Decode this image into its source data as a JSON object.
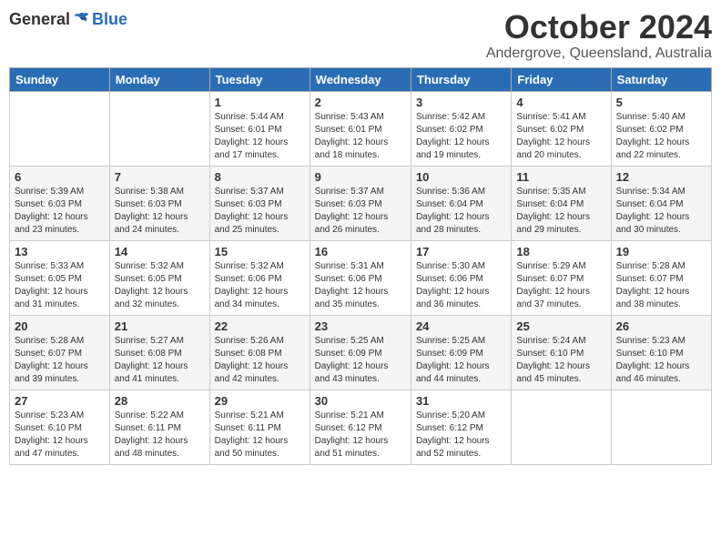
{
  "header": {
    "logo_general": "General",
    "logo_blue": "Blue",
    "month_title": "October 2024",
    "location": "Andergrove, Queensland, Australia"
  },
  "days_of_week": [
    "Sunday",
    "Monday",
    "Tuesday",
    "Wednesday",
    "Thursday",
    "Friday",
    "Saturday"
  ],
  "weeks": [
    [
      {
        "day": "",
        "info": ""
      },
      {
        "day": "",
        "info": ""
      },
      {
        "day": "1",
        "info": "Sunrise: 5:44 AM\nSunset: 6:01 PM\nDaylight: 12 hours\nand 17 minutes."
      },
      {
        "day": "2",
        "info": "Sunrise: 5:43 AM\nSunset: 6:01 PM\nDaylight: 12 hours\nand 18 minutes."
      },
      {
        "day": "3",
        "info": "Sunrise: 5:42 AM\nSunset: 6:02 PM\nDaylight: 12 hours\nand 19 minutes."
      },
      {
        "day": "4",
        "info": "Sunrise: 5:41 AM\nSunset: 6:02 PM\nDaylight: 12 hours\nand 20 minutes."
      },
      {
        "day": "5",
        "info": "Sunrise: 5:40 AM\nSunset: 6:02 PM\nDaylight: 12 hours\nand 22 minutes."
      }
    ],
    [
      {
        "day": "6",
        "info": "Sunrise: 5:39 AM\nSunset: 6:03 PM\nDaylight: 12 hours\nand 23 minutes."
      },
      {
        "day": "7",
        "info": "Sunrise: 5:38 AM\nSunset: 6:03 PM\nDaylight: 12 hours\nand 24 minutes."
      },
      {
        "day": "8",
        "info": "Sunrise: 5:37 AM\nSunset: 6:03 PM\nDaylight: 12 hours\nand 25 minutes."
      },
      {
        "day": "9",
        "info": "Sunrise: 5:37 AM\nSunset: 6:03 PM\nDaylight: 12 hours\nand 26 minutes."
      },
      {
        "day": "10",
        "info": "Sunrise: 5:36 AM\nSunset: 6:04 PM\nDaylight: 12 hours\nand 28 minutes."
      },
      {
        "day": "11",
        "info": "Sunrise: 5:35 AM\nSunset: 6:04 PM\nDaylight: 12 hours\nand 29 minutes."
      },
      {
        "day": "12",
        "info": "Sunrise: 5:34 AM\nSunset: 6:04 PM\nDaylight: 12 hours\nand 30 minutes."
      }
    ],
    [
      {
        "day": "13",
        "info": "Sunrise: 5:33 AM\nSunset: 6:05 PM\nDaylight: 12 hours\nand 31 minutes."
      },
      {
        "day": "14",
        "info": "Sunrise: 5:32 AM\nSunset: 6:05 PM\nDaylight: 12 hours\nand 32 minutes."
      },
      {
        "day": "15",
        "info": "Sunrise: 5:32 AM\nSunset: 6:06 PM\nDaylight: 12 hours\nand 34 minutes."
      },
      {
        "day": "16",
        "info": "Sunrise: 5:31 AM\nSunset: 6:06 PM\nDaylight: 12 hours\nand 35 minutes."
      },
      {
        "day": "17",
        "info": "Sunrise: 5:30 AM\nSunset: 6:06 PM\nDaylight: 12 hours\nand 36 minutes."
      },
      {
        "day": "18",
        "info": "Sunrise: 5:29 AM\nSunset: 6:07 PM\nDaylight: 12 hours\nand 37 minutes."
      },
      {
        "day": "19",
        "info": "Sunrise: 5:28 AM\nSunset: 6:07 PM\nDaylight: 12 hours\nand 38 minutes."
      }
    ],
    [
      {
        "day": "20",
        "info": "Sunrise: 5:28 AM\nSunset: 6:07 PM\nDaylight: 12 hours\nand 39 minutes."
      },
      {
        "day": "21",
        "info": "Sunrise: 5:27 AM\nSunset: 6:08 PM\nDaylight: 12 hours\nand 41 minutes."
      },
      {
        "day": "22",
        "info": "Sunrise: 5:26 AM\nSunset: 6:08 PM\nDaylight: 12 hours\nand 42 minutes."
      },
      {
        "day": "23",
        "info": "Sunrise: 5:25 AM\nSunset: 6:09 PM\nDaylight: 12 hours\nand 43 minutes."
      },
      {
        "day": "24",
        "info": "Sunrise: 5:25 AM\nSunset: 6:09 PM\nDaylight: 12 hours\nand 44 minutes."
      },
      {
        "day": "25",
        "info": "Sunrise: 5:24 AM\nSunset: 6:10 PM\nDaylight: 12 hours\nand 45 minutes."
      },
      {
        "day": "26",
        "info": "Sunrise: 5:23 AM\nSunset: 6:10 PM\nDaylight: 12 hours\nand 46 minutes."
      }
    ],
    [
      {
        "day": "27",
        "info": "Sunrise: 5:23 AM\nSunset: 6:10 PM\nDaylight: 12 hours\nand 47 minutes."
      },
      {
        "day": "28",
        "info": "Sunrise: 5:22 AM\nSunset: 6:11 PM\nDaylight: 12 hours\nand 48 minutes."
      },
      {
        "day": "29",
        "info": "Sunrise: 5:21 AM\nSunset: 6:11 PM\nDaylight: 12 hours\nand 50 minutes."
      },
      {
        "day": "30",
        "info": "Sunrise: 5:21 AM\nSunset: 6:12 PM\nDaylight: 12 hours\nand 51 minutes."
      },
      {
        "day": "31",
        "info": "Sunrise: 5:20 AM\nSunset: 6:12 PM\nDaylight: 12 hours\nand 52 minutes."
      },
      {
        "day": "",
        "info": ""
      },
      {
        "day": "",
        "info": ""
      }
    ]
  ]
}
